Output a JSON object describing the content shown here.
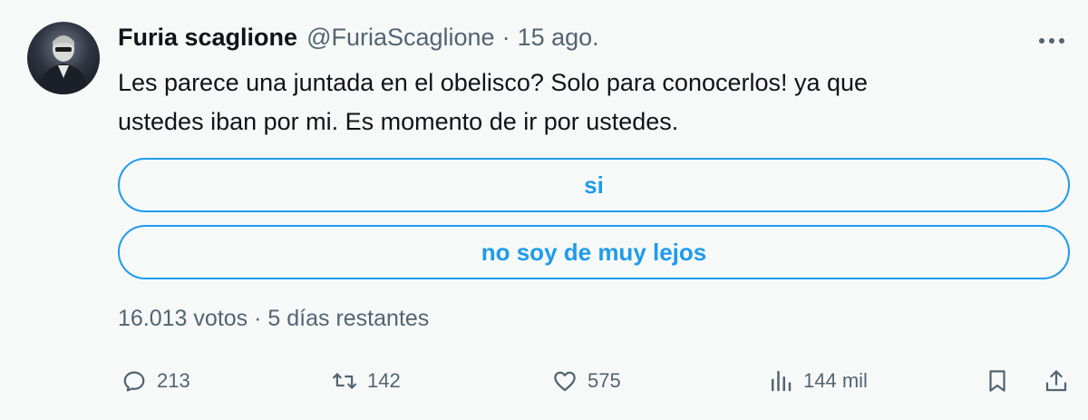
{
  "tweet": {
    "author_name": "Furia scaglione",
    "author_handle": "@FuriaScaglione",
    "separator": "·",
    "date": "15 ago.",
    "text_line1": "Les parece una juntada en el obelisco? Solo para conocerlos! ya que",
    "text_line2": "ustedes iban por mi. Es momento de ir por ustedes."
  },
  "poll": {
    "options": [
      {
        "label": "si"
      },
      {
        "label": "no soy de muy lejos"
      }
    ],
    "votes": "16.013 votos",
    "separator": "·",
    "time_left": "5 días restantes"
  },
  "actions": {
    "replies": "213",
    "retweets": "142",
    "likes": "575",
    "views": "144 mil"
  },
  "icons": {
    "more": "more-horizontal-icon",
    "reply": "reply-icon",
    "retweet": "retweet-icon",
    "like": "heart-icon",
    "views": "views-chart-icon",
    "bookmark": "bookmark-icon",
    "share": "share-icon"
  },
  "colors": {
    "accent": "#1d9bf0",
    "text": "#0f1419",
    "secondary_text": "#536471",
    "background": "#f7f9f9"
  }
}
